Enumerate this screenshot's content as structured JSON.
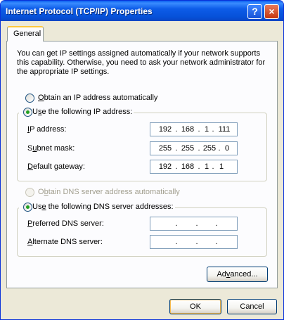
{
  "window": {
    "title": "Internet Protocol (TCP/IP) Properties",
    "help_glyph": "?",
    "close_glyph": "×"
  },
  "tabs": [
    {
      "label": "General",
      "selected": true
    }
  ],
  "intro_text": "You can get IP settings assigned automatically if your network supports this capability. Otherwise, you need to ask your network administrator for the appropriate IP settings.",
  "ip": {
    "auto_option": {
      "mnemonic": "O",
      "rest": "btain an IP address automatically",
      "checked": false
    },
    "manual_option": {
      "pre": "U",
      "mnemonic": "s",
      "rest": "e the following IP address:",
      "checked": true
    },
    "fields": [
      {
        "pre": "",
        "mnemonic": "I",
        "rest": "P address:",
        "octets": [
          "192",
          "168",
          "1",
          "111"
        ]
      },
      {
        "pre": "S",
        "mnemonic": "u",
        "rest": "bnet mask:",
        "octets": [
          "255",
          "255",
          "255",
          "0"
        ]
      },
      {
        "pre": "",
        "mnemonic": "D",
        "rest": "efault gateway:",
        "octets": [
          "192",
          "168",
          "1",
          "1"
        ]
      }
    ]
  },
  "dns": {
    "auto_option": {
      "pre": "O",
      "mnemonic": "b",
      "rest": "tain DNS server address automatically",
      "checked": false,
      "disabled": true
    },
    "manual_option": {
      "pre": "Us",
      "mnemonic": "e",
      "rest": " the following DNS server addresses:",
      "checked": true
    },
    "fields": [
      {
        "pre": "",
        "mnemonic": "P",
        "rest": "referred DNS server:",
        "octets": [
          "",
          "",
          "",
          ""
        ]
      },
      {
        "pre": "",
        "mnemonic": "A",
        "rest": "lternate DNS server:",
        "octets": [
          "",
          "",
          "",
          ""
        ]
      }
    ]
  },
  "buttons": {
    "advanced": {
      "pre": "Ad",
      "mnemonic": "v",
      "rest": "anced..."
    },
    "ok": "OK",
    "cancel": "Cancel"
  },
  "colors": {
    "title_bar": "#0a5fef",
    "dialog_face": "#ece9d8",
    "radio_dot": "#21a121",
    "input_border": "#7f9db9"
  }
}
